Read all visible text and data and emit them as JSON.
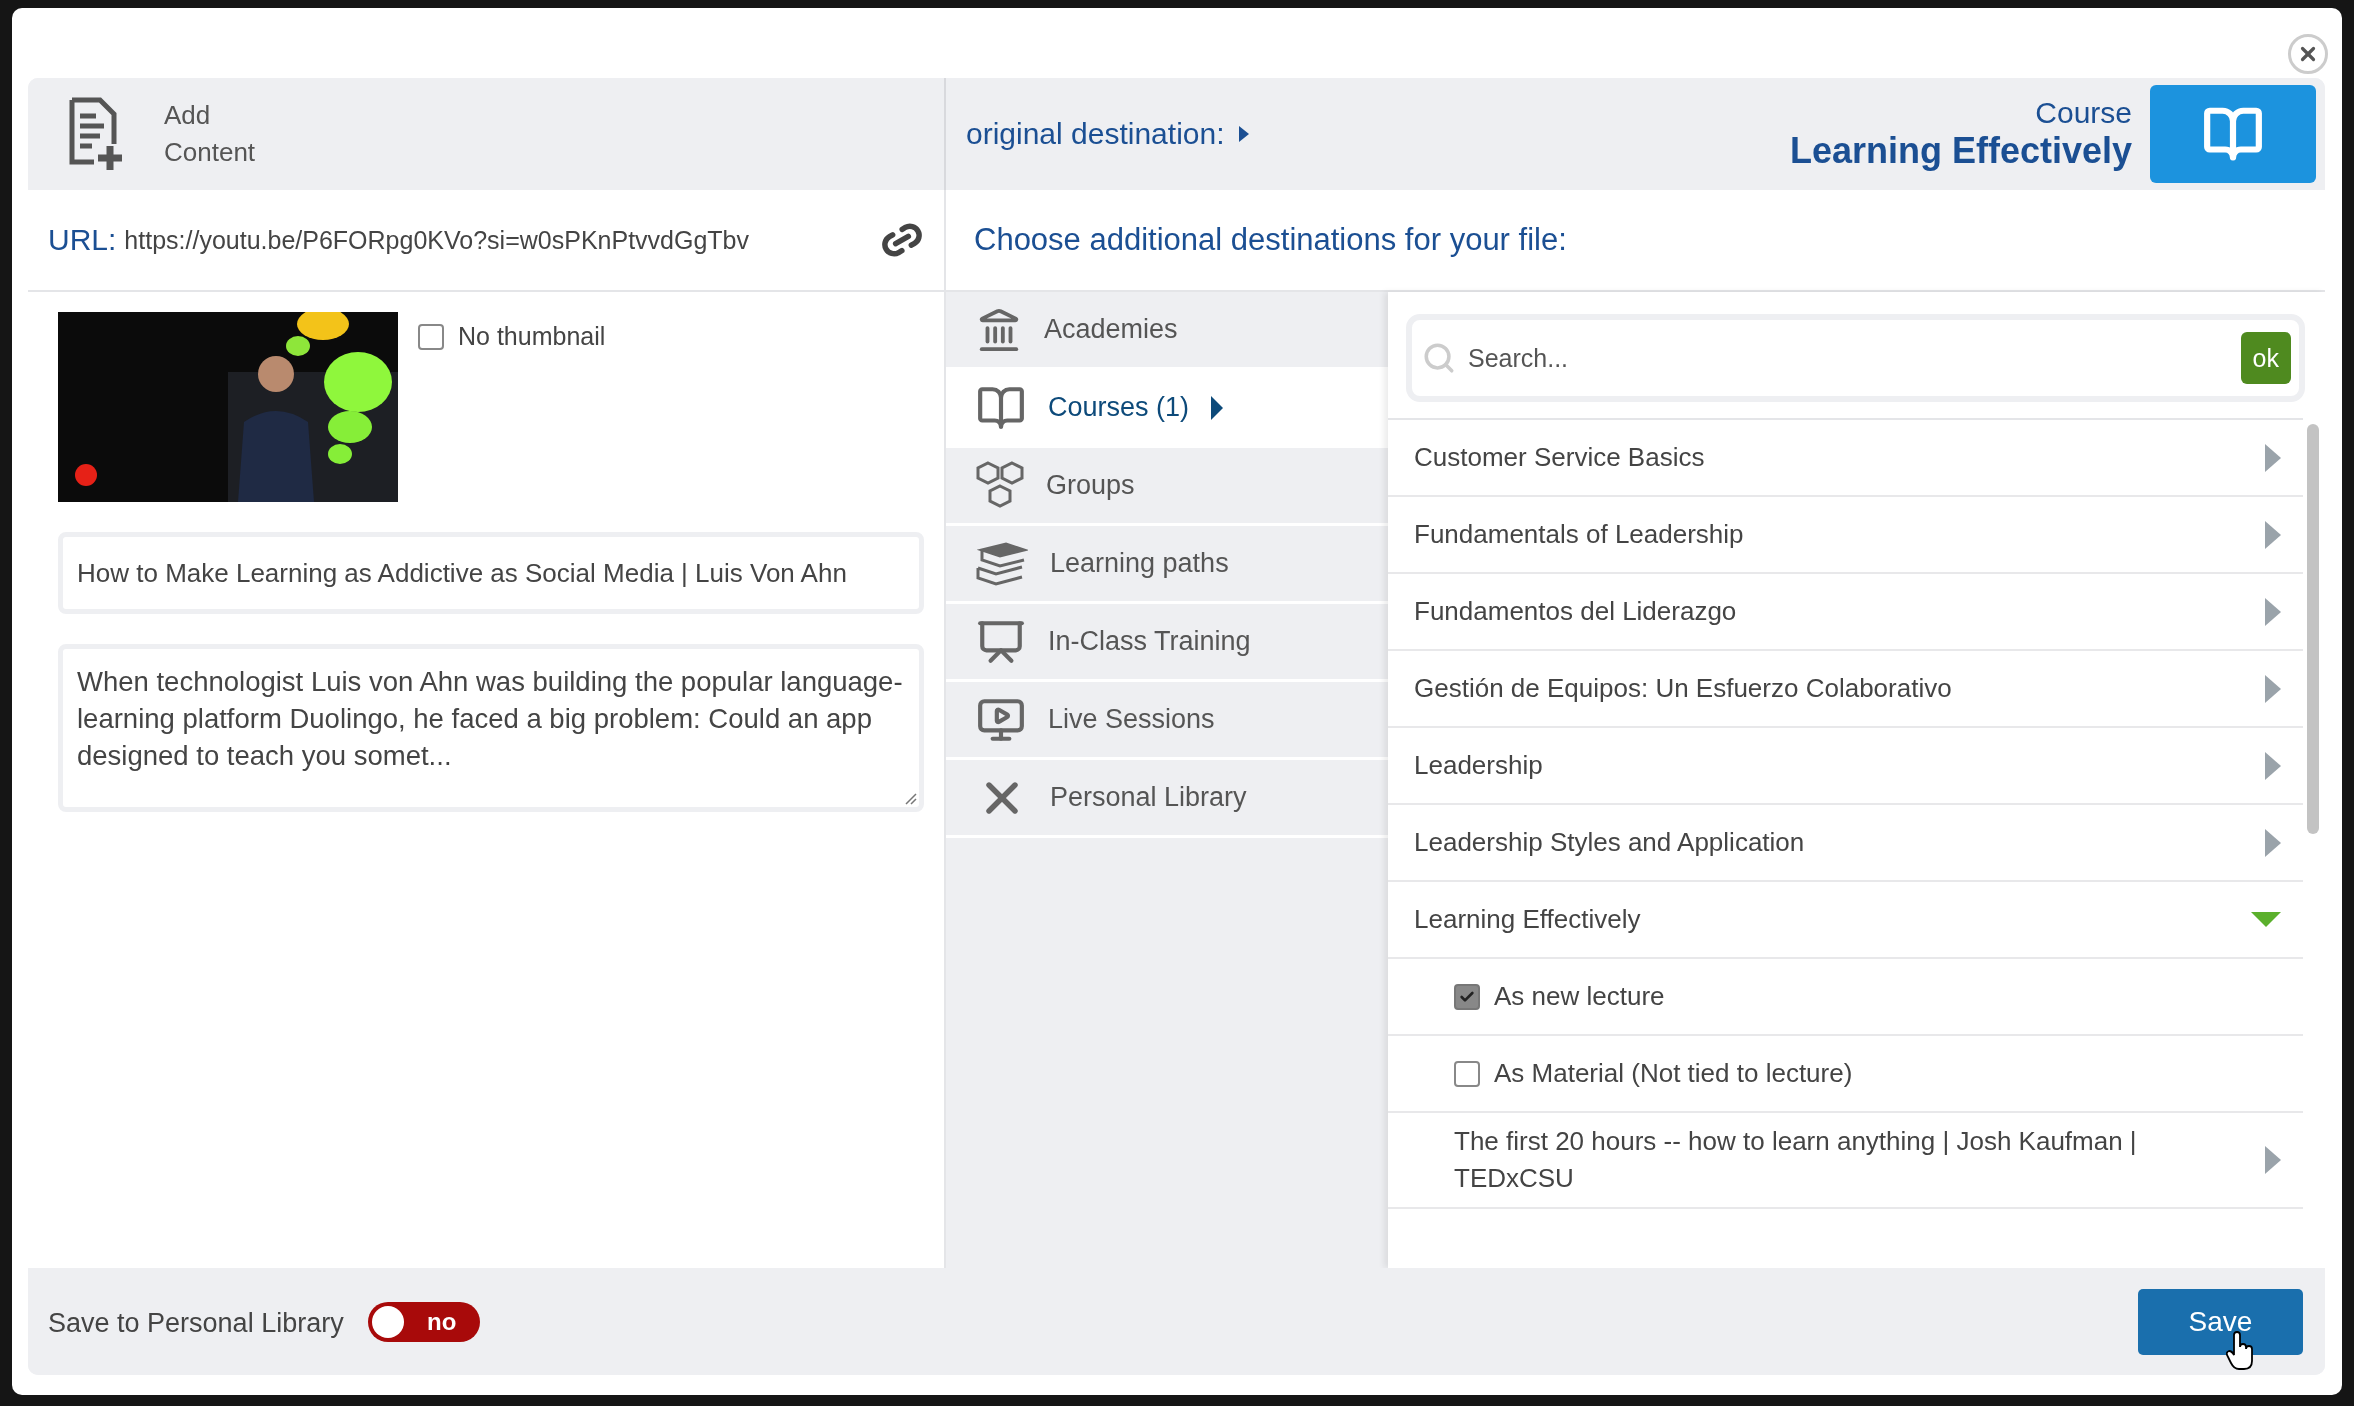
{
  "header": {
    "title": "Add Content",
    "original_destination": "original destination:",
    "course_type": "Course",
    "course_name": "Learning Effectively"
  },
  "url": {
    "label": "URL:",
    "value": "https://youtu.be/P6FORpg0KVo?si=w0sPKnPtvvdGgTbv"
  },
  "no_thumbnail": {
    "label": "No thumbnail",
    "checked": false
  },
  "title_field": {
    "value": "How to Make Learning as Addictive as Social Media | Luis Von Ahn"
  },
  "description_field": {
    "value": "When technologist Luis von Ahn was building the popular language-learning platform Duolingo, he faced a big problem: Could an app designed to teach you somet..."
  },
  "destinations_heading": "Choose additional destinations for your file:",
  "categories": [
    {
      "kind": "academies",
      "label": "Academies",
      "selected": false
    },
    {
      "kind": "courses",
      "label": "Courses (1)",
      "selected": true
    },
    {
      "kind": "groups",
      "label": "Groups",
      "selected": false
    },
    {
      "kind": "paths",
      "label": "Learning paths",
      "selected": false
    },
    {
      "kind": "classroom",
      "label": "In-Class Training",
      "selected": false
    },
    {
      "kind": "live",
      "label": "Live Sessions",
      "selected": false
    },
    {
      "kind": "library",
      "label": "Personal Library",
      "selected": false
    }
  ],
  "search": {
    "placeholder": "Search...",
    "button": "ok"
  },
  "courses": [
    {
      "label": "Customer Service Basics",
      "expanded": false
    },
    {
      "label": "Fundamentals of Leadership",
      "expanded": false
    },
    {
      "label": "Fundamentos del Liderazgo",
      "expanded": false
    },
    {
      "label": "Gestión de Equipos: Un Esfuerzo Colaborativo",
      "expanded": false
    },
    {
      "label": "Leadership",
      "expanded": false
    },
    {
      "label": "Leadership Styles and Application",
      "expanded": false
    },
    {
      "label": "Learning Effectively",
      "expanded": true,
      "children": [
        {
          "kind": "option",
          "label": "As new lecture",
          "checked": true
        },
        {
          "kind": "option",
          "label": "As Material (Not tied to lecture)",
          "checked": false
        },
        {
          "kind": "lecture",
          "label": "The first 20 hours -- how to learn anything | Josh Kaufman | TEDxCSU"
        }
      ]
    }
  ],
  "footer": {
    "save_to_library": {
      "label": "Save to Personal Library",
      "on": false,
      "state_text": "no"
    },
    "save_button": "Save"
  }
}
